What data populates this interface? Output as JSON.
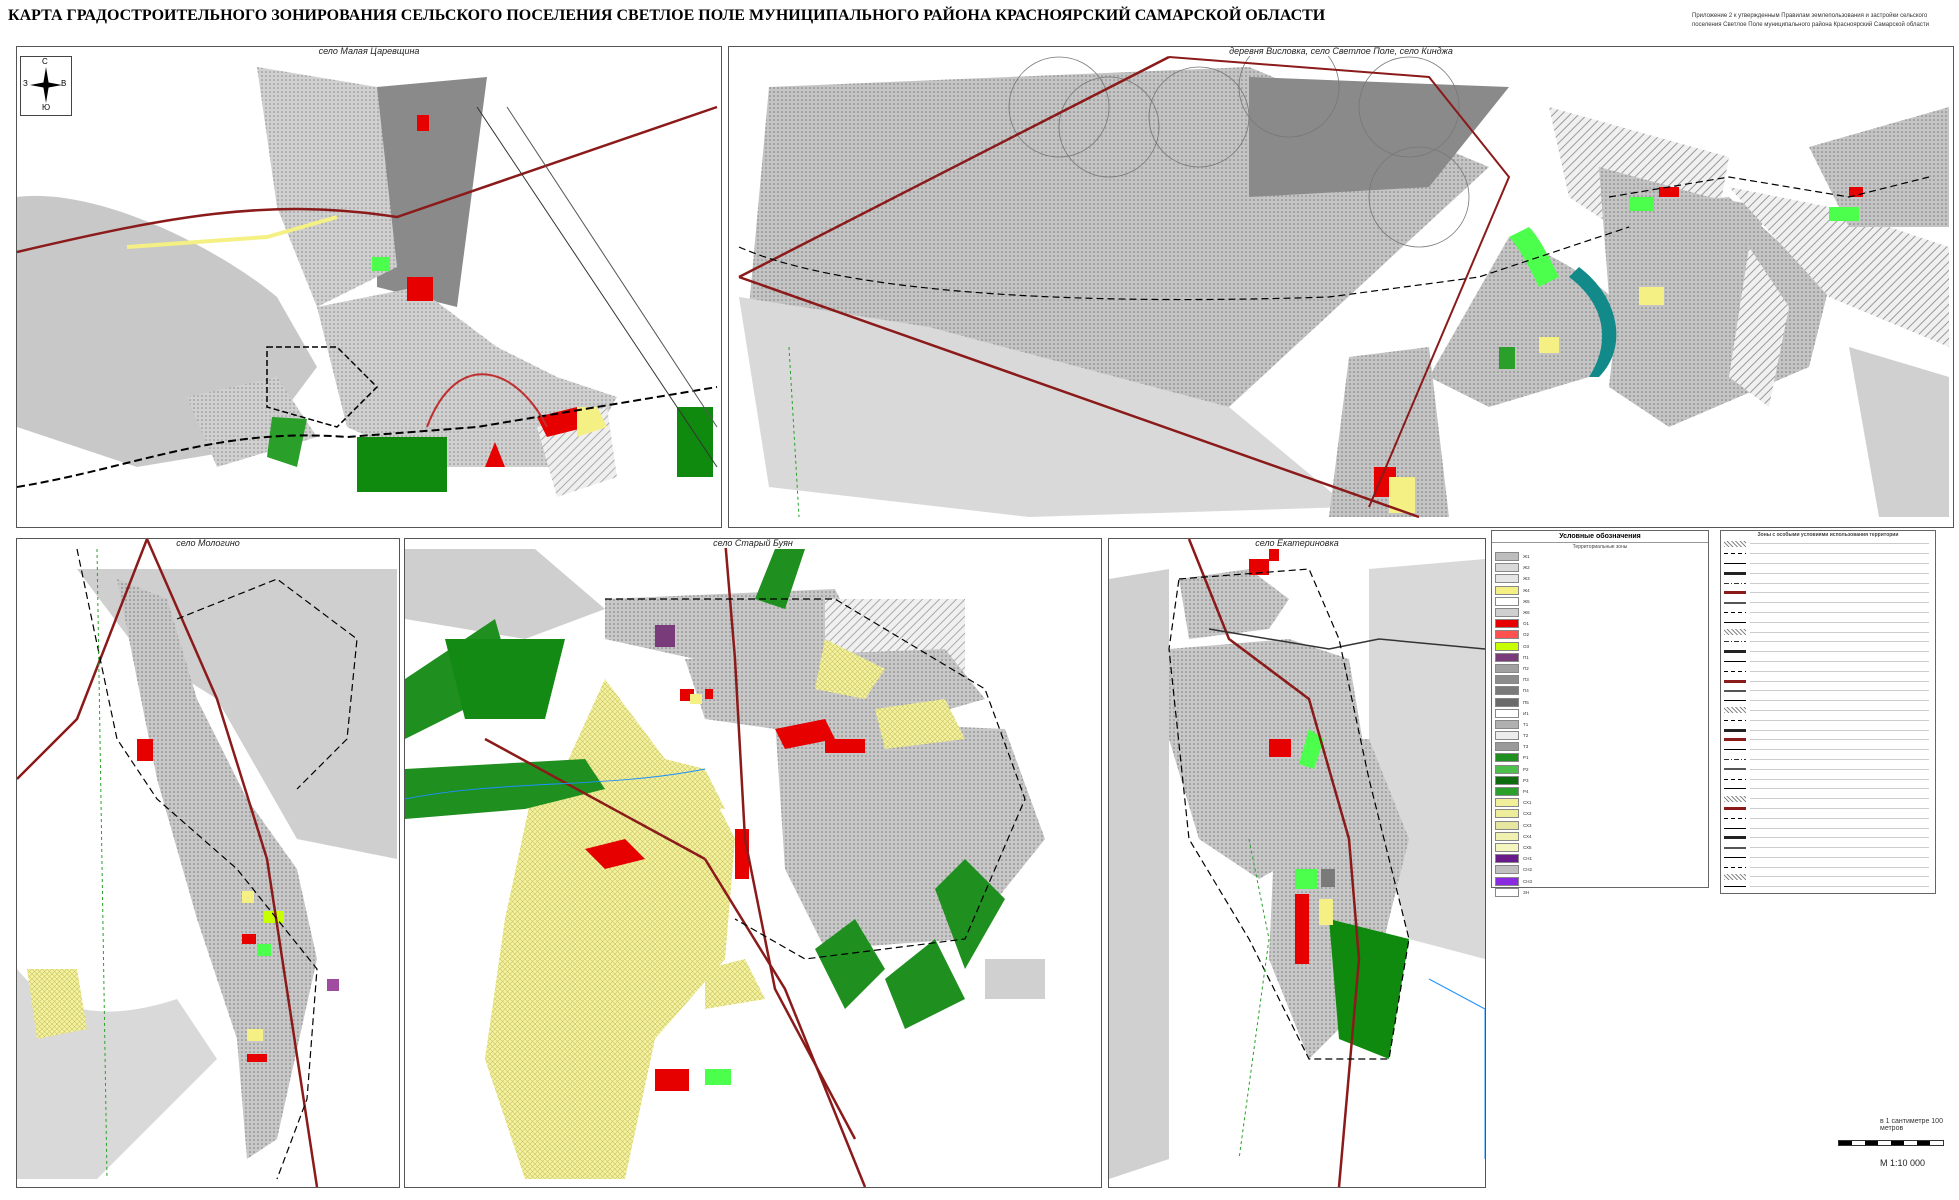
{
  "title": "КАРТА ГРАДОСТРОИТЕЛЬНОГО ЗОНИРОВАНИЯ СЕЛЬСКОГО ПОСЕЛЕНИЯ СВЕТЛОЕ ПОЛЕ МУНИЦИПАЛЬНОГО РАЙОНА КРАСНОЯРСКИЙ САМАРСКОЙ ОБЛАСТИ",
  "note": "Приложение 2 к утвержденным Правилам землепользования и застройки сельского поселения Светлое Поле муниципального района Красноярский Самарской области",
  "panels": [
    {
      "label": "село Малая Царевщина"
    },
    {
      "label": "деревня Висловка, село Светлое Поле, село Кинджа"
    },
    {
      "label": "село Мологино"
    },
    {
      "label": "село Старый Буян"
    },
    {
      "label": "село Екатериновка"
    }
  ],
  "compass": {
    "n": "С",
    "s": "Ю",
    "w": "З",
    "e": "В"
  },
  "legend": {
    "title": "Условные обозначения",
    "subtitle": "Территориальные зоны",
    "items": [
      {
        "code": "Ж1",
        "color": "#bdbdbd"
      },
      {
        "code": "Ж2",
        "color": "#d9d9d9"
      },
      {
        "code": "Ж3",
        "color": "#e6e6e6"
      },
      {
        "code": "Ж4",
        "color": "#f4f083"
      },
      {
        "code": "Ж5",
        "color": "#ffffff"
      },
      {
        "code": "Ж6",
        "color": "#cfcfcf"
      },
      {
        "code": "О1",
        "color": "#e60000"
      },
      {
        "code": "О2",
        "color": "#ff5050"
      },
      {
        "code": "О3",
        "color": "#c8ff00"
      },
      {
        "code": "П1",
        "color": "#7a3b7a"
      },
      {
        "code": "П2",
        "color": "#a0a0a0"
      },
      {
        "code": "П3",
        "color": "#8c8c8c"
      },
      {
        "code": "П4",
        "color": "#7a7a7a"
      },
      {
        "code": "П5",
        "color": "#6b6b6b"
      },
      {
        "code": "И1",
        "color": "#ffffff"
      },
      {
        "code": "Т1",
        "color": "#b0b0b0"
      },
      {
        "code": "Т2",
        "color": "#ececec"
      },
      {
        "code": "Т3",
        "color": "#9a9a9a"
      },
      {
        "code": "Р1",
        "color": "#1f8f1f"
      },
      {
        "code": "Р2",
        "color": "#4cbf4c"
      },
      {
        "code": "Р3",
        "color": "#0f6b0f"
      },
      {
        "code": "Р4",
        "color": "#2aa02a"
      },
      {
        "code": "СХ1",
        "color": "#f2ef9a"
      },
      {
        "code": "СХ2",
        "color": "#ecec9a"
      },
      {
        "code": "СХ3",
        "color": "#e6e6a0"
      },
      {
        "code": "СХ4",
        "color": "#f0f0b0"
      },
      {
        "code": "СХ5",
        "color": "#f5f5c0"
      },
      {
        "code": "СН1",
        "color": "#6a1b8a"
      },
      {
        "code": "СН2",
        "color": "#c0c0c0"
      },
      {
        "code": "СН3",
        "color": "#8a2be2"
      },
      {
        "code": "ЗН",
        "color": "#ffffff"
      }
    ]
  },
  "legend2": {
    "title": "Зоны с особыми условиями использования территории",
    "items": [
      {
        "style": "hatch"
      },
      {
        "style": "dash"
      },
      {
        "style": "solid"
      },
      {
        "style": "thick"
      },
      {
        "style": "dashdot"
      },
      {
        "style": "red"
      },
      {
        "style": "dark"
      },
      {
        "style": "dash"
      },
      {
        "style": "solid"
      },
      {
        "style": "hatch"
      },
      {
        "style": "dashdot"
      },
      {
        "style": "thick"
      },
      {
        "style": "solid"
      },
      {
        "style": "dash"
      },
      {
        "style": "red"
      },
      {
        "style": "dark"
      },
      {
        "style": "solid"
      },
      {
        "style": "hatch"
      },
      {
        "style": "dash"
      },
      {
        "style": "thick"
      },
      {
        "style": "red"
      },
      {
        "style": "solid"
      },
      {
        "style": "dashdot"
      },
      {
        "style": "dark"
      },
      {
        "style": "dash"
      },
      {
        "style": "solid"
      },
      {
        "style": "hatch"
      },
      {
        "style": "red"
      },
      {
        "style": "dash"
      },
      {
        "style": "solid"
      },
      {
        "style": "thick"
      },
      {
        "style": "dark"
      },
      {
        "style": "solid"
      },
      {
        "style": "dash"
      },
      {
        "style": "hatch"
      },
      {
        "style": "solid"
      }
    ]
  },
  "scale": {
    "label": "М 1:10 000",
    "bar_caption": "в 1 сантиметре 100 метров"
  }
}
